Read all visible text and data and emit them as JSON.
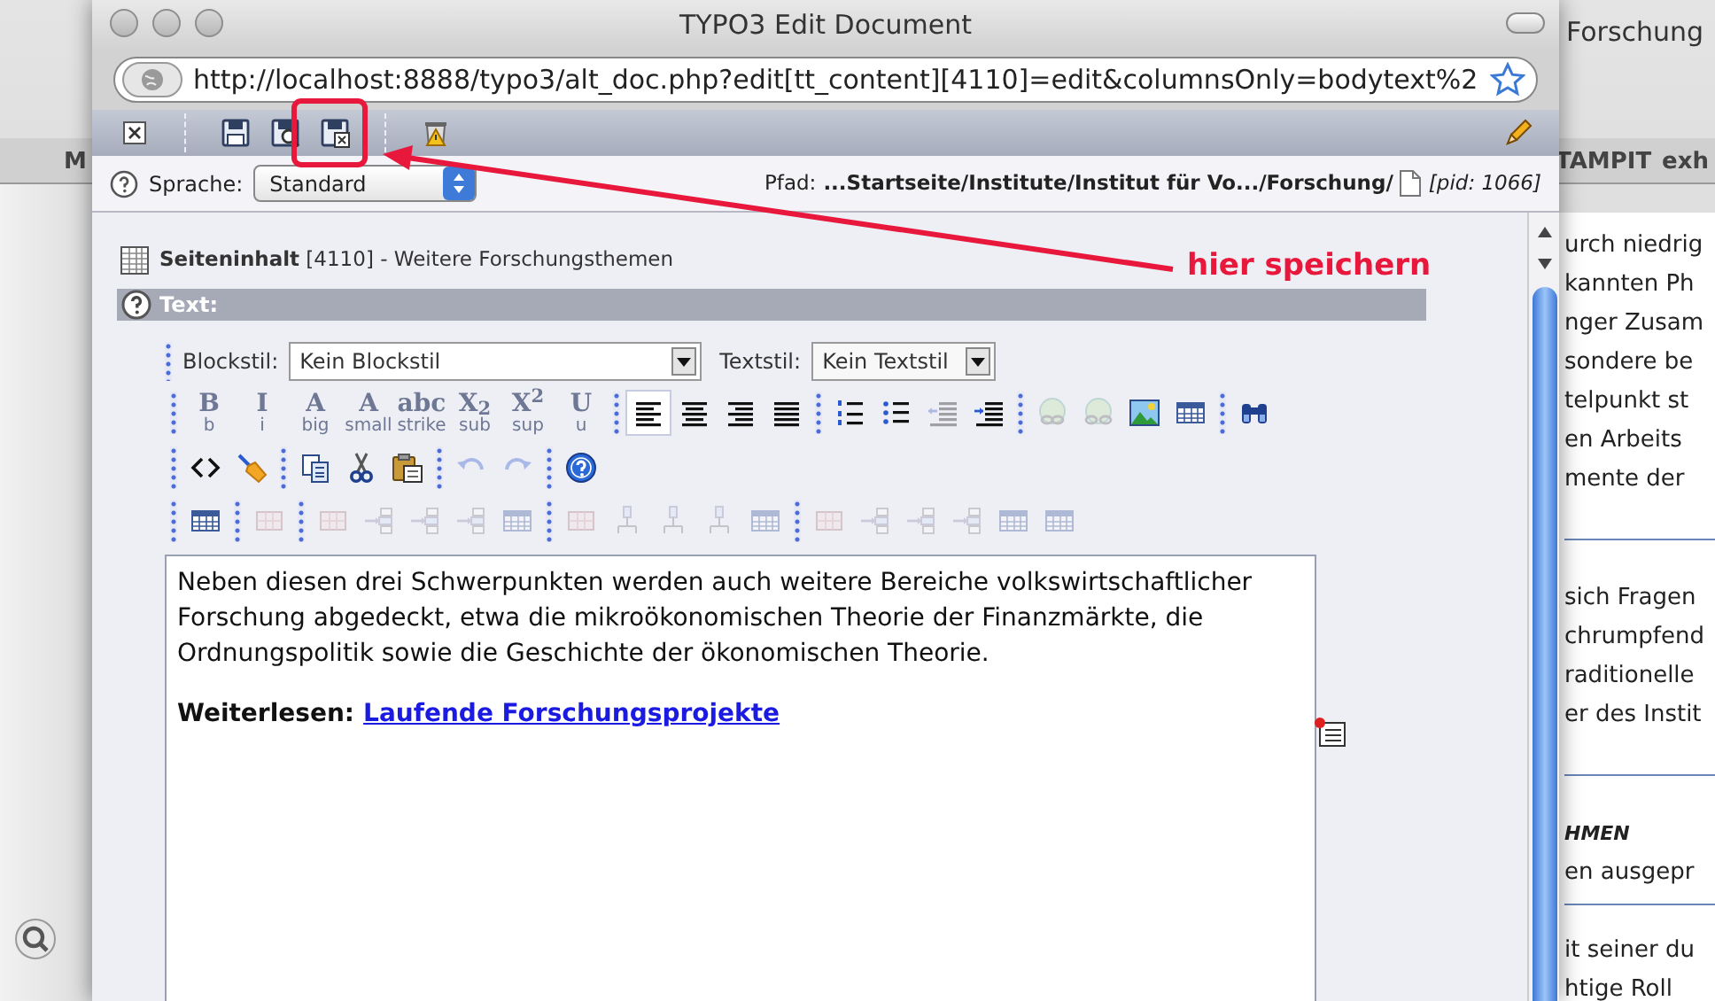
{
  "background_window": {
    "title": "Forschung",
    "tabs": [
      "M",
      "TAMPIT",
      "exh"
    ],
    "text_lines": [
      "urch niedrig",
      "kannten Ph",
      "nger Zusam",
      "sondere be",
      "telpunkt st",
      "en  Arbeits",
      "mente der",
      "sich Fragen",
      "chrumpfend",
      "raditionelle",
      "er des Instit",
      "HMEN",
      "en ausgepr",
      "it seiner du",
      "htige Roll"
    ]
  },
  "window": {
    "title": "TYPO3 Edit Document",
    "url": "http://localhost:8888/typo3/alt_doc.php?edit[tt_content][4110]=edit&columnsOnly=bodytext%2"
  },
  "doc_toolbar": [
    {
      "kind": "close"
    },
    {
      "kind": "separator"
    },
    {
      "kind": "save"
    },
    {
      "kind": "save-view"
    },
    {
      "kind": "save-close"
    },
    {
      "kind": "separator"
    },
    {
      "kind": "delete"
    }
  ],
  "language": {
    "label": "Sprache:",
    "value": "Standard"
  },
  "path": {
    "label": "Pfad:",
    "value": "...Startseite/Institute/Institut für Vo.../Forschung/",
    "pid": "[pid: 1066]"
  },
  "record_title": "**Seiteninhalt** [4110] - Weitere Forschungsthemen",
  "section": {
    "title": "Text:"
  },
  "block_style": {
    "label": "Blockstil:",
    "value": "Kein Blockstil"
  },
  "text_style": {
    "label": "Textstil:",
    "value": "Kein Textstil"
  },
  "button_rows": [
    [
      [
        {
          "kind": "format",
          "glyph": "B",
          "caption": "b",
          "disabled": true
        },
        {
          "kind": "format",
          "glyph": "I",
          "caption": "i",
          "disabled": true
        },
        {
          "kind": "format",
          "glyph": "A",
          "caption": "big",
          "disabled": true
        },
        {
          "kind": "format",
          "glyph": "A",
          "caption": "small",
          "disabled": true
        },
        {
          "kind": "format",
          "glyph": "abc",
          "caption": "strike",
          "disabled": true
        },
        {
          "kind": "format",
          "glyph": "X$_{2}$",
          "caption": "sub",
          "disabled": true
        },
        {
          "kind": "format",
          "glyph": "X$^{2}$",
          "caption": "sup",
          "disabled": true
        },
        {
          "kind": "format",
          "glyph": "U",
          "caption": "u",
          "disabled": true
        }
      ],
      [
        {
          "kind": "align-left",
          "selected": true,
          "disabled": false
        },
        {
          "kind": "align-center",
          "selected": false,
          "disabled": false
        },
        {
          "kind": "align-right",
          "selected": false,
          "disabled": false
        },
        {
          "kind": "justify",
          "selected": false,
          "disabled": false
        }
      ],
      [
        {
          "kind": "ordered-list",
          "disabled": false
        },
        {
          "kind": "unordered-list",
          "disabled": false
        },
        {
          "kind": "outdent",
          "disabled": true
        },
        {
          "kind": "indent",
          "disabled": false
        }
      ],
      [
        {
          "kind": "link",
          "disabled": true
        },
        {
          "kind": "unlink",
          "disabled": true
        },
        {
          "kind": "image",
          "disabled": false
        },
        {
          "kind": "table",
          "disabled": false
        }
      ],
      [
        {
          "kind": "find",
          "disabled": false
        }
      ]
    ],
    [
      [
        {
          "kind": "html",
          "disabled": false
        },
        {
          "kind": "cleanup",
          "disabled": false
        }
      ],
      [
        {
          "kind": "copy",
          "disabled": false
        },
        {
          "kind": "cut",
          "disabled": false
        },
        {
          "kind": "paste",
          "disabled": false
        }
      ],
      [
        {
          "kind": "undo",
          "disabled": true
        },
        {
          "kind": "redo",
          "disabled": true
        }
      ],
      [
        {
          "kind": "help",
          "disabled": false
        }
      ]
    ],
    [
      [
        {
          "kind": "table",
          "disabled": false
        }
      ],
      [
        {
          "kind": "table-props",
          "disabled": true
        }
      ],
      [
        {
          "kind": "row-props",
          "disabled": true
        },
        {
          "kind": "row-insert-above",
          "disabled": true
        },
        {
          "kind": "row-insert-below",
          "disabled": true
        },
        {
          "kind": "row-delete",
          "disabled": true
        },
        {
          "kind": "row-split",
          "disabled": true
        }
      ],
      [
        {
          "kind": "col-props",
          "disabled": true
        },
        {
          "kind": "col-insert-left",
          "disabled": true
        },
        {
          "kind": "col-insert-right",
          "disabled": true
        },
        {
          "kind": "col-delete",
          "disabled": true
        },
        {
          "kind": "col-split",
          "disabled": true
        }
      ],
      [
        {
          "kind": "cell-props",
          "disabled": true
        },
        {
          "kind": "cell-insert-left",
          "disabled": true
        },
        {
          "kind": "cell-insert-right",
          "disabled": true
        },
        {
          "kind": "cell-delete",
          "disabled": true
        },
        {
          "kind": "cell-split",
          "disabled": true
        },
        {
          "kind": "cell-merge",
          "disabled": true
        }
      ]
    ]
  ],
  "body_text": "Neben diesen drei Schwerpunkten werden auch weitere Bereiche volkswirtschaftlicher Forschung abgedeckt, etwa die mikroökonomischen Theorie der Finanzmärkte, die Ordnungspolitik sowie die Geschichte der ökonomischen Theorie.",
  "read_more": {
    "label": "Weiterlesen:",
    "link": "Laufende Forschungsprojekte"
  },
  "annotation": {
    "text": "hier speichern"
  }
}
